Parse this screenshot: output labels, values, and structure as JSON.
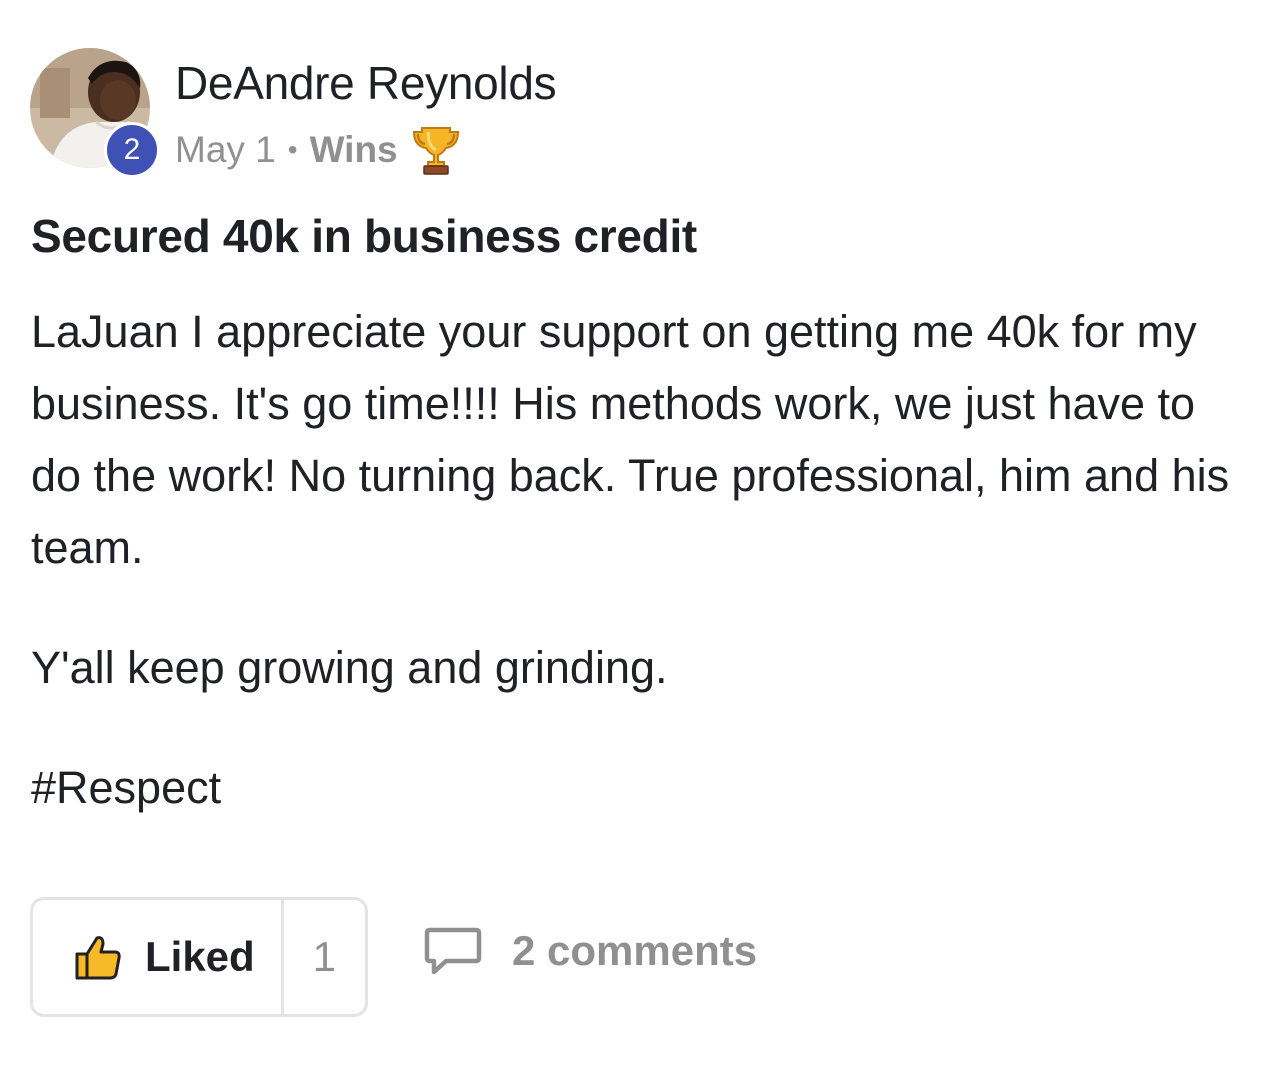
{
  "author": {
    "name": "DeAndre Reynolds",
    "level": "2",
    "avatar_icon": "user-avatar-photo"
  },
  "meta": {
    "date": "May 1",
    "separator": "•",
    "category": "Wins",
    "category_icon": "trophy-icon"
  },
  "post": {
    "title": "Secured 40k in business credit",
    "paragraphs": [
      "LaJuan I appreciate your support on getting me 40k for my business. It's go time!!!! His methods work, we just have to do the work! No turning back. True professional, him and his team.",
      "Y'all keep growing and grinding.",
      "#Respect"
    ]
  },
  "actions": {
    "like_label": "Liked",
    "like_count": "1",
    "like_icon": "thumbs-up-icon",
    "comments_label": "2 comments",
    "comments_icon": "comment-bubble-icon"
  },
  "colors": {
    "level_badge": "#3f51b5",
    "muted_text": "#909090",
    "primary_text": "#202124",
    "like_icon_fill": "#f7b928",
    "border": "#e4e4e4"
  }
}
